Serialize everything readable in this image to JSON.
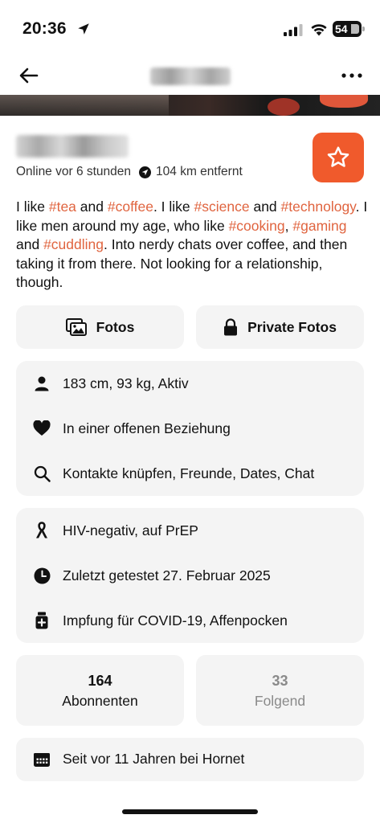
{
  "status_bar": {
    "time": "20:36",
    "battery": "54"
  },
  "nav": {
    "back_icon": "arrow-left-icon",
    "more_icon": "more-horizontal-icon"
  },
  "profile": {
    "online_status": "Online vor 6 stunden",
    "distance": "104 km entfernt",
    "favorite_icon": "star-icon",
    "accent_color": "#f05a2c"
  },
  "bio": {
    "segments": [
      {
        "text": "I like ",
        "tag": false
      },
      {
        "text": "#tea",
        "tag": true
      },
      {
        "text": " and ",
        "tag": false
      },
      {
        "text": "#coffee",
        "tag": true
      },
      {
        "text": ". I like ",
        "tag": false
      },
      {
        "text": "#science",
        "tag": true
      },
      {
        "text": " and ",
        "tag": false
      },
      {
        "text": "#technology",
        "tag": true
      },
      {
        "text": ". I like men around my age, who like ",
        "tag": false
      },
      {
        "text": "#cooking",
        "tag": true
      },
      {
        "text": ", ",
        "tag": false
      },
      {
        "text": "#gaming",
        "tag": true
      },
      {
        "text": " and ",
        "tag": false
      },
      {
        "text": "#cuddling",
        "tag": true
      },
      {
        "text": ". Into nerdy chats over coffee, and then taking it from there. Not looking for a relationship, though.",
        "tag": false
      }
    ],
    "tag_color": "#e0643f"
  },
  "buttons": {
    "photos_label": "Fotos",
    "private_photos_label": "Private Fotos"
  },
  "stats_card": {
    "body": "183 cm, 93 kg, Aktiv",
    "relationship": "In einer offenen Beziehung",
    "looking_for": "Kontakte knüpfen, Freunde, Dates, Chat"
  },
  "health_card": {
    "hiv_status": "HIV-negativ, auf PrEP",
    "last_tested": "Zuletzt getestet 27. Februar 2025",
    "vaccinations": "Impfung für COVID-19, Affenpocken"
  },
  "followers": {
    "count": "164",
    "label": "Abonnenten"
  },
  "following": {
    "count": "33",
    "label": "Folgend"
  },
  "member_since": "Seit vor 11 Jahren bei Hornet"
}
